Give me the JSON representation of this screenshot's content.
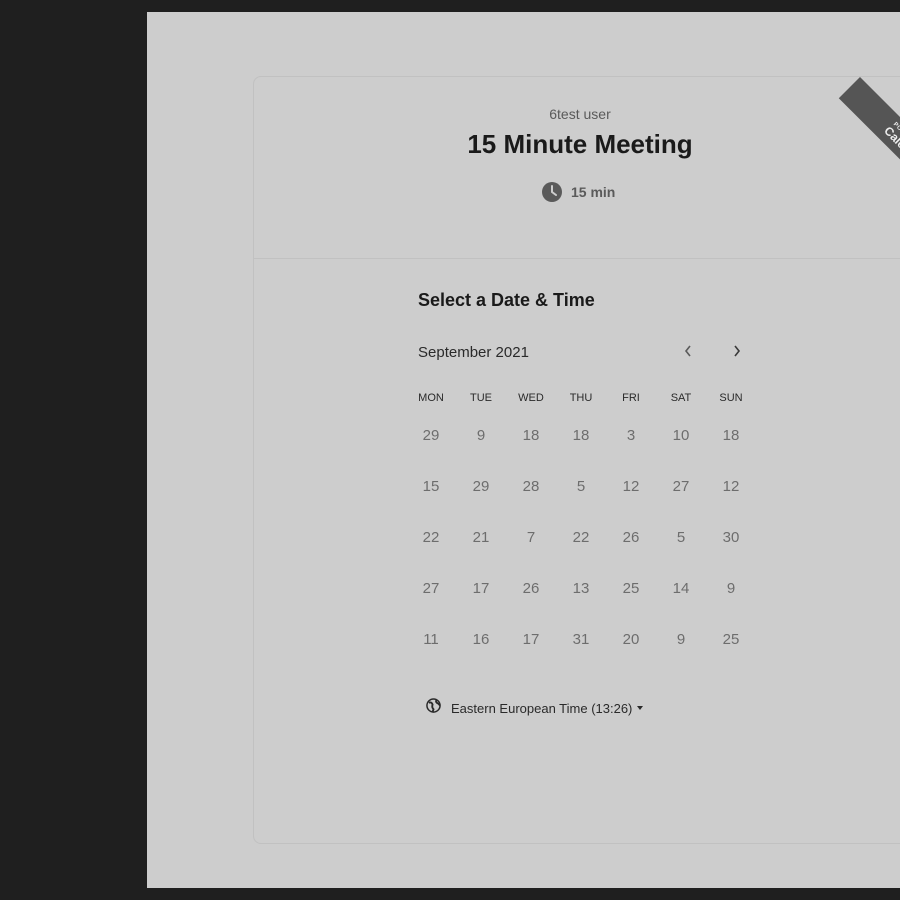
{
  "event": {
    "owner": "6test user",
    "title": "15 Minute Meeting",
    "duration": "15 min"
  },
  "badge": {
    "top": "POWERED BY",
    "brand": "Calendly"
  },
  "calendar": {
    "section_title": "Select a Date & Time",
    "month": "September 2021",
    "weekdays": [
      "MON",
      "TUE",
      "WED",
      "THU",
      "FRI",
      "SAT",
      "SUN"
    ],
    "weeks": [
      [
        "29",
        "9",
        "18",
        "18",
        "3",
        "10",
        "18"
      ],
      [
        "15",
        "29",
        "28",
        "5",
        "12",
        "27",
        "12"
      ],
      [
        "22",
        "21",
        "7",
        "22",
        "26",
        "5",
        "30"
      ],
      [
        "27",
        "17",
        "26",
        "13",
        "25",
        "14",
        "9"
      ],
      [
        "11",
        "16",
        "17",
        "31",
        "20",
        "9",
        "25"
      ]
    ]
  },
  "timezone": {
    "label": "Eastern European Time (13:26)"
  },
  "icons": {
    "duration": "clock-icon",
    "prev": "chevron-left-icon",
    "next": "chevron-right-icon",
    "timezone": "globe-icon"
  }
}
